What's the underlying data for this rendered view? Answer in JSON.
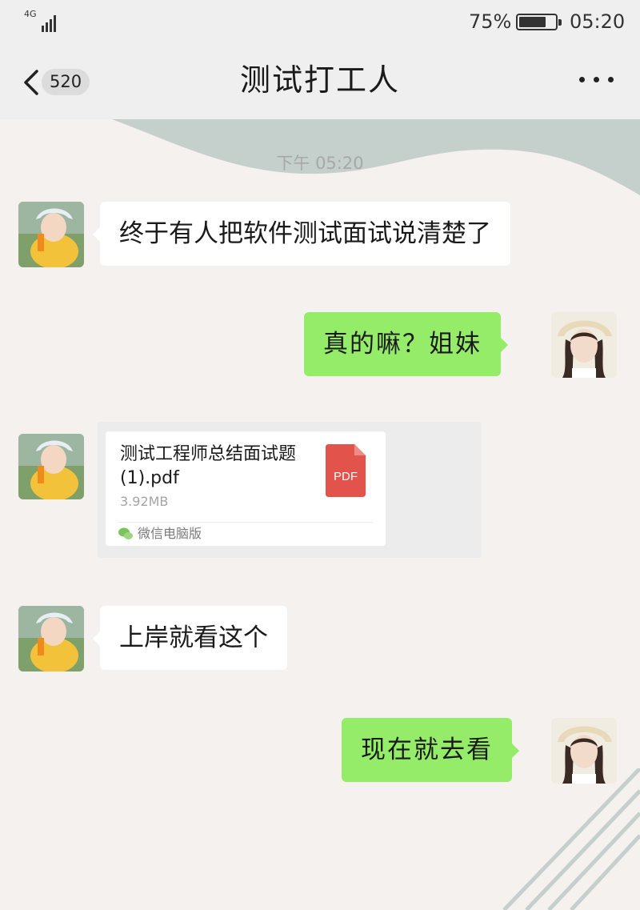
{
  "status_bar": {
    "network": "4G",
    "network_sub": "4G",
    "battery_percent": "75%",
    "battery_level": 0.75,
    "time": "05:20"
  },
  "nav": {
    "back_count": "520",
    "title": "测试打工人",
    "more_icon": "more-dots-icon"
  },
  "chat": {
    "timestamp": "下午 05:20",
    "messages": [
      {
        "side": "in",
        "type": "text",
        "text": "终于有人把软件测试面试说清楚了"
      },
      {
        "side": "out",
        "type": "text",
        "text": "真的嘛？姐妹"
      },
      {
        "side": "in",
        "type": "file",
        "file_name": "测试工程师总结面试题 (1).pdf",
        "file_size": "3.92MB",
        "file_type": "PDF",
        "source": "微信电脑版"
      },
      {
        "side": "in",
        "type": "text",
        "text": "上岸就看这个"
      },
      {
        "side": "out",
        "type": "text",
        "text": "现在就去看"
      }
    ]
  },
  "colors": {
    "outgoing_bubble": "#95ec69",
    "incoming_bubble": "#ffffff",
    "pdf_icon": "#e2534c",
    "deco_wave": "#c5d0cc"
  }
}
